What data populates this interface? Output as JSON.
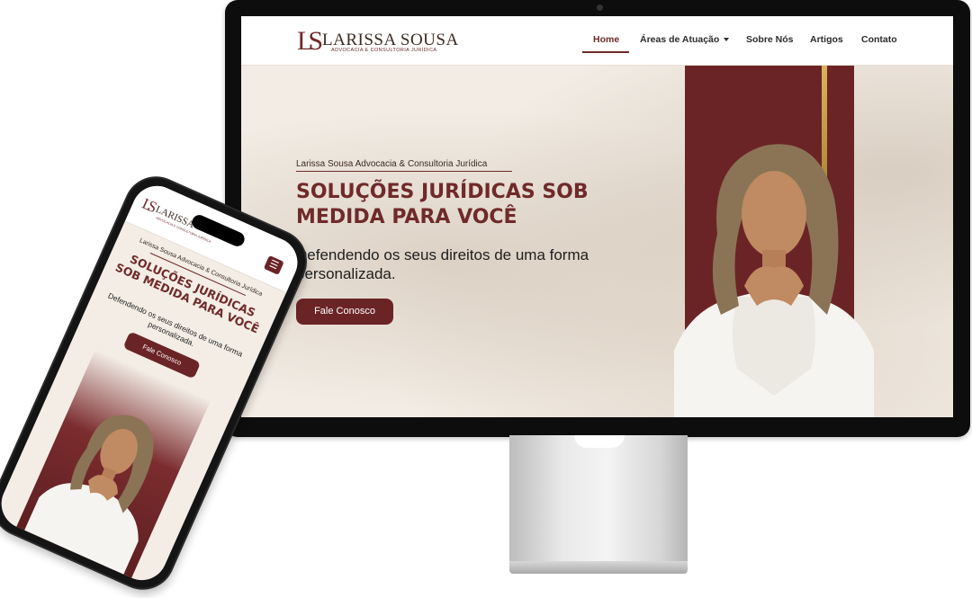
{
  "brand": {
    "logo_mark": "LS",
    "name": "LARISSA SOUSA",
    "tagline": "ADVOCACIA E CONSULTORIA JURÍDICA"
  },
  "nav": {
    "home": "Home",
    "areas": "Áreas de Atuação",
    "sobre": "Sobre Nós",
    "artigos": "Artigos",
    "contato": "Contato"
  },
  "hero": {
    "eyebrow": "Larissa Sousa Advocacia & Consultoria Jurídica",
    "title": "SOLUÇÕES JURÍDICAS SOB MEDIDA PARA VOCÊ",
    "subtitle": "Defendendo os seus direitos de uma forma personalizada.",
    "cta": "Fale Conosco"
  },
  "mobile": {
    "menu_icon": "hamburger-icon",
    "brand_name": "LARISSA",
    "brand_tagline": "ADVOCACIA E CONSULTORIA JURÍDICA"
  },
  "colors": {
    "primary": "#6b2426",
    "gold": "#d9b45a",
    "background": "#f2ece4"
  }
}
